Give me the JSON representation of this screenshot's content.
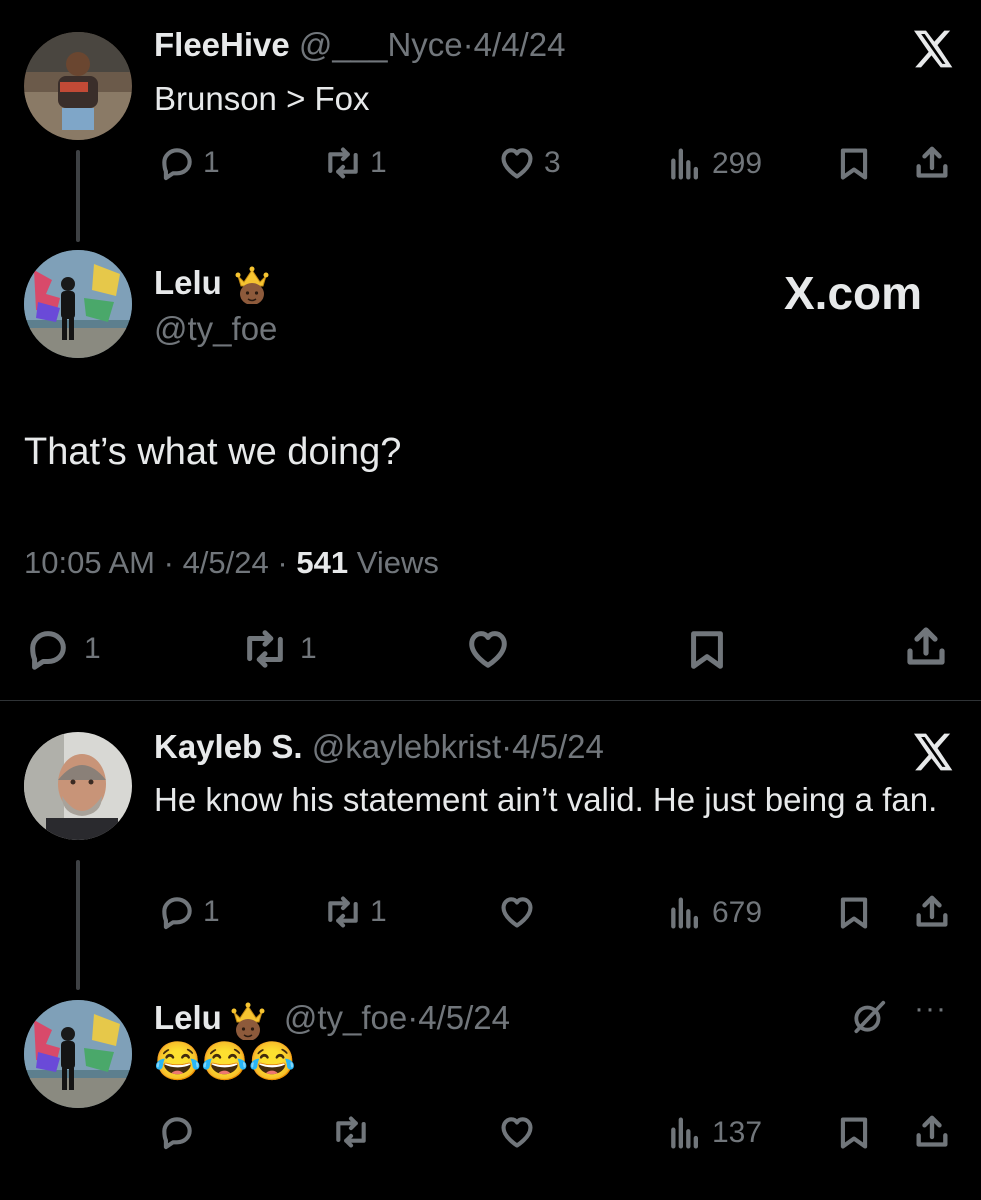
{
  "tweet1": {
    "display_name": "FleeHive",
    "handle": "@___Nyce",
    "sep": "·",
    "date": "4/4/24",
    "text": "Brunson > Fox",
    "replies": "1",
    "reposts": "1",
    "likes": "3",
    "views": "299"
  },
  "main_tweet": {
    "display_name": "Lelu",
    "handle": "@ty_foe",
    "badge": "X.com",
    "text": "That’s what we doing?",
    "time": "10:05 AM",
    "sep": "·",
    "date": "4/5/24",
    "views_count": "541",
    "views_label": "Views",
    "replies": "1",
    "reposts": "1"
  },
  "tweet3": {
    "display_name": "Kayleb S.",
    "handle": "@kaylebkrist",
    "sep": "·",
    "date": "4/5/24",
    "text": "He know his statement ain’t valid. He just being a fan.",
    "replies": "1",
    "reposts": "1",
    "views": "679"
  },
  "tweet4": {
    "display_name": "Lelu",
    "handle": "@ty_foe",
    "sep": "·",
    "date": "4/5/24",
    "text": "😂😂😂",
    "views": "137",
    "more": "···"
  },
  "colors": {
    "background": "#000000",
    "text": "#e7e9ea",
    "muted": "#71767b",
    "divider": "#2f3336"
  },
  "icons": [
    "reply-icon",
    "repost-icon",
    "like-icon",
    "views-icon",
    "bookmark-icon",
    "share-icon",
    "x-logo-icon",
    "crown-emoji",
    "grok-icon",
    "more-icon"
  ]
}
